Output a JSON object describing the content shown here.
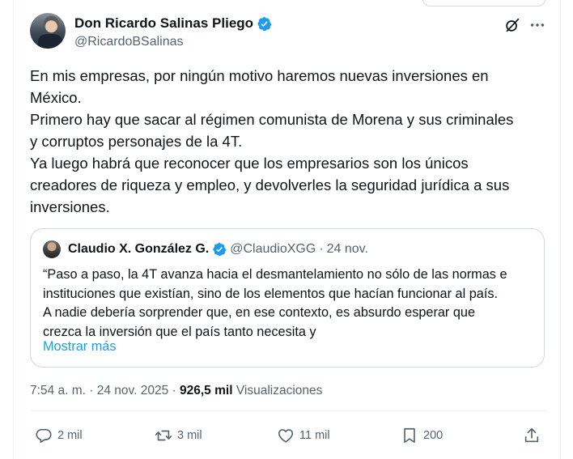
{
  "post": {
    "author_name": "Don Ricardo Salinas Pliego",
    "author_handle": "@RicardoBSalinas",
    "text": "En mis empresas, por ningún motivo haremos nuevas inversiones en\nMéxico.\nPrimero hay que sacar al régimen comunista de Morena y sus criminales\ny corruptos personajes de la 4T.\nYa luego habrá que reconocer que los empresarios son los únicos\ncreadores de riqueza y empleo, y devolverles la seguridad jurídica a sus\ninversiones."
  },
  "quote": {
    "author_name": "Claudio X. González G.",
    "author_handle": "@ClaudioXGG",
    "separator": "·",
    "date": "24 nov.",
    "text": "“Paso a paso, la 4T avanza hacia el desmantelamiento no sólo de las normas e\ninstituciones que existían, sino de los elementos que hacían funcionar al país.\nA nadie debería sorprender que, en ese contexto, es absurdo esperar que\ncrezca la inversión que el país tanto necesita y",
    "show_more": "Mostrar más"
  },
  "meta": {
    "time": "7:54 a. m.",
    "separator": "·",
    "date": "24 nov. 2025",
    "views_count": "926,5 mil",
    "views_label": "Visualizaciones"
  },
  "actions": {
    "replies": "2 mil",
    "reposts": "3 mil",
    "likes": "11 mil",
    "bookmarks": "200"
  },
  "icons": {
    "verified": "verified-badge-icon",
    "grok": "grok-icon",
    "more": "more-dots-icon",
    "reply": "reply-icon",
    "repost": "repost-icon",
    "like": "heart-icon",
    "bookmark": "bookmark-icon",
    "share": "share-icon"
  },
  "colors": {
    "verified_blue": "#1d9bf0",
    "secondary_text": "#536471",
    "primary_text": "#0f1419",
    "border": "#cfd9de"
  }
}
